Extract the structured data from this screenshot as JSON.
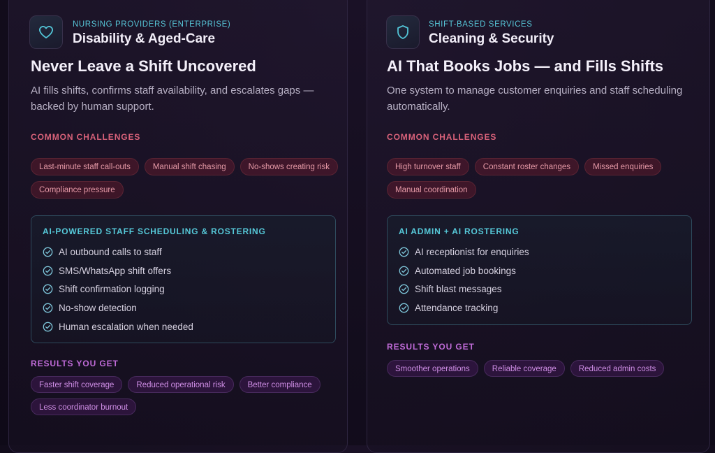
{
  "cards": [
    {
      "eyebrow": "NURSING PROVIDERS (ENTERPRISE)",
      "title": "Disability & Aged-Care",
      "icon": "heart-icon",
      "headline": "Never Leave a Shift Uncovered",
      "subtext": "AI fills shifts, confirms staff availability, and escalates gaps — backed by human support.",
      "challenges_label": "COMMON CHALLENGES",
      "challenges": [
        "Last-minute staff call-outs",
        "Manual shift chasing",
        "No-shows creating risk",
        "Compliance pressure"
      ],
      "feature_title": "AI-POWERED STAFF SCHEDULING & ROSTERING",
      "features": [
        "AI outbound calls to staff",
        "SMS/WhatsApp shift offers",
        "Shift confirmation logging",
        "No-show detection",
        "Human escalation when needed"
      ],
      "results_label": "RESULTS YOU GET",
      "results": [
        "Faster shift coverage",
        "Reduced operational risk",
        "Better compliance",
        "Less coordinator burnout"
      ]
    },
    {
      "eyebrow": "SHIFT-BASED SERVICES",
      "title": "Cleaning & Security",
      "icon": "shield-icon",
      "headline": "AI That Books Jobs — and Fills Shifts",
      "subtext": "One system to manage customer enquiries and staff scheduling automatically.",
      "challenges_label": "COMMON CHALLENGES",
      "challenges": [
        "High turnover staff",
        "Constant roster changes",
        "Missed enquiries",
        "Manual coordination"
      ],
      "feature_title": "AI ADMIN + AI ROSTERING",
      "features": [
        "AI receptionist for enquiries",
        "Automated job bookings",
        "Shift blast messages",
        "Attendance tracking"
      ],
      "results_label": "RESULTS YOU GET",
      "results": [
        "Smoother operations",
        "Reliable coverage",
        "Reduced admin costs"
      ]
    }
  ],
  "colors": {
    "accent_cyan": "#56c8d8",
    "challenge_red": "#d9627a",
    "result_purple": "#c06bd8",
    "background": "#130d1d"
  }
}
